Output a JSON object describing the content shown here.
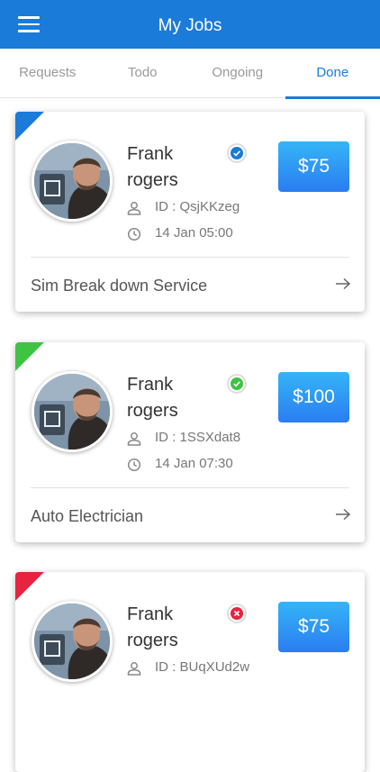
{
  "header": {
    "title": "My Jobs",
    "menu_icon": "hamburger-menu-icon",
    "color": "#1b7bd8"
  },
  "tabs": [
    {
      "label": "Requests",
      "active": false
    },
    {
      "label": "Todo",
      "active": false
    },
    {
      "label": "Ongoing",
      "active": false
    },
    {
      "label": "Done",
      "active": true
    }
  ],
  "jobs": [
    {
      "name_first": "Frank",
      "name_last": "rogers",
      "id_label": "ID : ",
      "id": "QsjKKzeg",
      "date": "14 Jan 05:00",
      "price": "$75",
      "service": "Sim Break down Service",
      "status": "approved-check-icon",
      "status_color": "#1b7bd8",
      "corner_color": "#1b7bd8"
    },
    {
      "name_first": "Frank",
      "name_last": "rogers",
      "id_label": "ID : ",
      "id": "1SSXdat8",
      "date": "14 Jan 07:30",
      "price": "$100",
      "service": "Auto Electrician",
      "status": "completed-check-icon",
      "status_color": "#3ec343",
      "corner_color": "#3ec343"
    },
    {
      "name_first": "Frank",
      "name_last": "rogers",
      "id_label": "ID : ",
      "id": "BUqXUd2w",
      "date": "",
      "price": "$75",
      "service": "",
      "status": "cancelled-x-icon",
      "status_color": "#e8233f",
      "corner_color": "#e8233f"
    }
  ]
}
